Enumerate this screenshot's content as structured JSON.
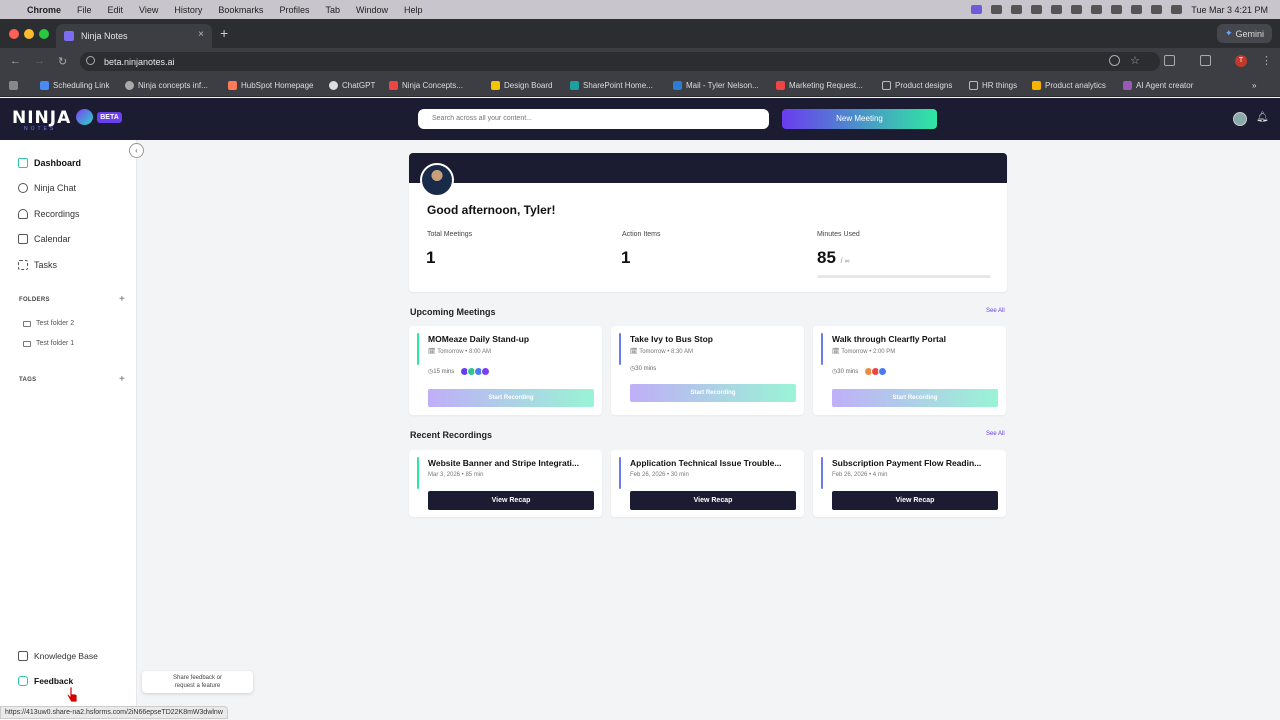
{
  "menubar": {
    "items": [
      "Chrome",
      "File",
      "Edit",
      "View",
      "History",
      "Bookmarks",
      "Profiles",
      "Tab",
      "Window",
      "Help"
    ],
    "datetime": "Tue Mar 3  4:21 PM"
  },
  "browser": {
    "tab_title": "Ninja Notes",
    "url": "beta.ninjanotes.ai",
    "gemini_label": "Gemini",
    "profile_initial": "T",
    "bookmarks": [
      "Scheduling Link",
      "Ninja concepts inf...",
      "HubSpot Homepage",
      "ChatGPT",
      "Ninja Concepts...",
      "Design Board",
      "SharePoint Home...",
      "Mail - Tyler Nelson...",
      "Marketing Request...",
      "Product designs",
      "HR things",
      "Product analytics",
      "AI Agent creator"
    ]
  },
  "app": {
    "logo": "NINJA",
    "logo_sub": "NOTES",
    "beta": "BETA",
    "search_placeholder": "Search across all your content...",
    "new_meeting": "New Meeting"
  },
  "sidebar": {
    "items": [
      {
        "label": "Dashboard"
      },
      {
        "label": "Ninja Chat"
      },
      {
        "label": "Recordings"
      },
      {
        "label": "Calendar"
      },
      {
        "label": "Tasks"
      }
    ],
    "folders_heading": "FOLDERS",
    "folders": [
      "Test folder 2",
      "Test folder 1"
    ],
    "tags_heading": "TAGS",
    "knowledge_base": "Knowledge Base",
    "feedback": "Feedback",
    "feedback_tooltip_line1": "Share feedback or",
    "feedback_tooltip_line2": "request a feature"
  },
  "status_url": "https://413uw0.share-na2.hsforms.com/2iN66epseTD22K8mW3dwlnw",
  "dashboard": {
    "greeting": "Good afternoon, Tyler!",
    "stats": [
      {
        "label": "Total Meetings",
        "value": "1"
      },
      {
        "label": "Action Items",
        "value": "1"
      },
      {
        "label": "Minutes Used",
        "value": "85",
        "suffix": "/ ∞"
      }
    ],
    "upcoming_title": "Upcoming Meetings",
    "see_all": "See All",
    "upcoming": [
      {
        "title": "MOMeaze Daily Stand-up",
        "when": "Tomorrow • 8:00 AM",
        "duration": "15 mins",
        "button": "Start Recording",
        "accent": "#2ee8a2"
      },
      {
        "title": "Take Ivy to Bus Stop",
        "when": "Tomorrow • 8:30 AM",
        "duration": "30 mins",
        "button": "Start Recording",
        "accent": "#6a7bf0"
      },
      {
        "title": "Walk through Clearfly Portal",
        "when": "Tomorrow • 2:00 PM",
        "duration": "30 mins",
        "button": "Start Recording",
        "accent": "#6a7bf0"
      }
    ],
    "recent_title": "Recent Recordings",
    "recent": [
      {
        "title": "Website Banner and Stripe Integrati...",
        "meta": "Mar 3, 2026 • 85 min",
        "button": "View Recap",
        "accent": "#2ee8a2"
      },
      {
        "title": "Application Technical Issue Trouble...",
        "meta": "Feb 26, 2026 • 30 min",
        "button": "View Recap",
        "accent": "#6a7bf0"
      },
      {
        "title": "Subscription Payment Flow Readin...",
        "meta": "Feb 26, 2026 • 4 min",
        "button": "View Recap",
        "accent": "#6a7bf0"
      }
    ]
  }
}
